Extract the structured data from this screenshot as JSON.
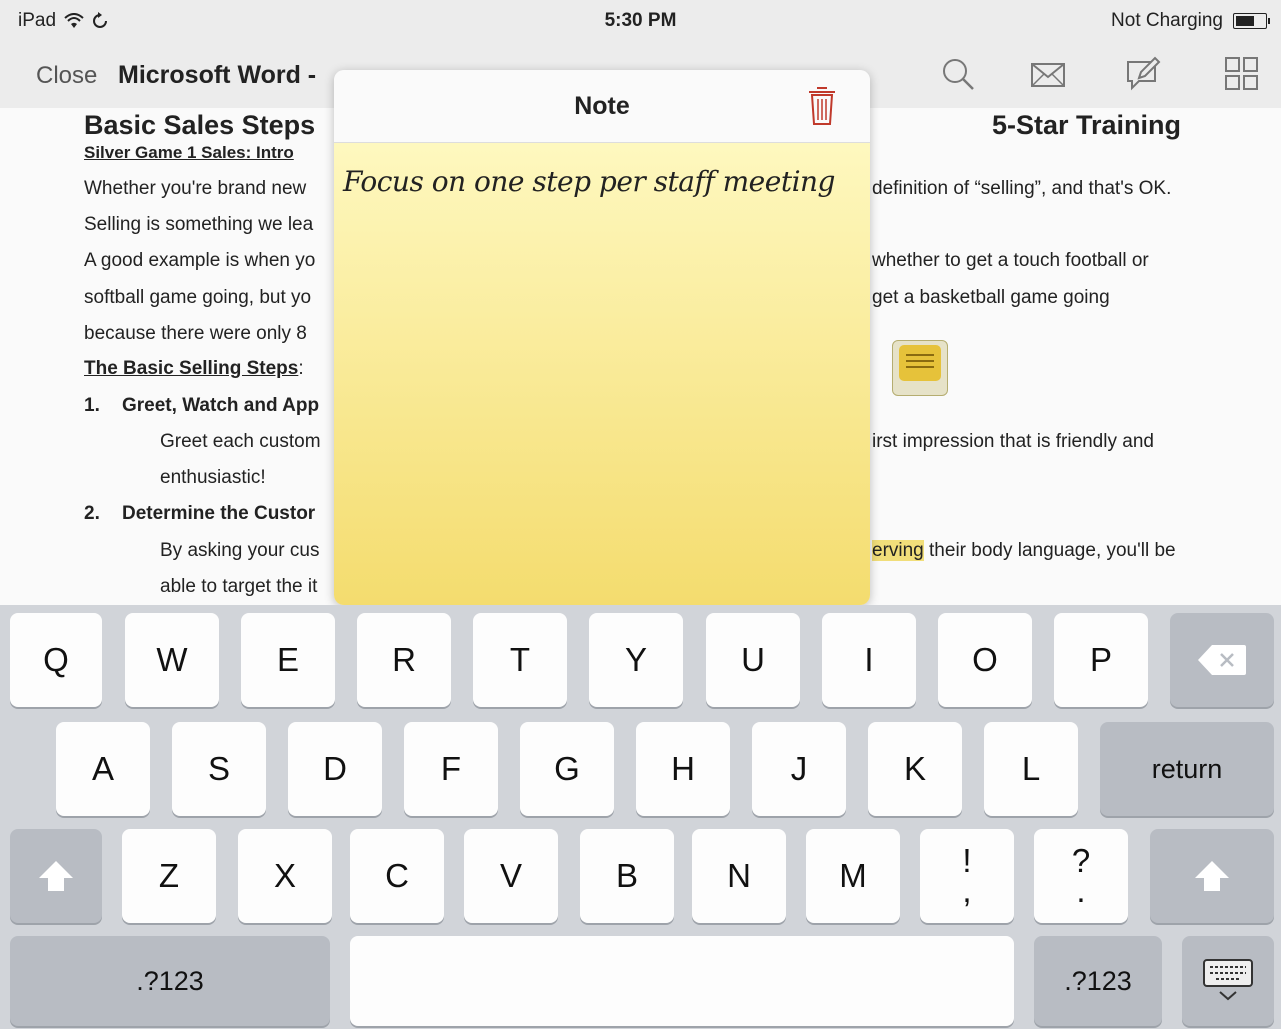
{
  "status": {
    "device": "iPad",
    "time": "5:30 PM",
    "battery_text": "Not Charging"
  },
  "toolbar": {
    "close": "Close",
    "title": "Microsoft Word - "
  },
  "document": {
    "title_left": "Basic Sales Steps",
    "title_right": "5-Star Training",
    "subtitle": "Silver Game 1 Sales: Intro",
    "lines_left": [
      "Whether you're brand new",
      "Selling is something we lea",
      "A good example is when yo",
      "softball game going, but yo",
      "because there were only 8"
    ],
    "lines_right": [
      "definition of “selling”, and that's OK.",
      "whether to get a touch football or",
      "get a basketball game going"
    ],
    "section": "The Basic Selling Steps",
    "step1_num": "1.",
    "step1": "Greet, Watch and App",
    "step1_text": "Greet each custom",
    "step1_right": "irst impression that is friendly and",
    "step1_cont": "enthusiastic!",
    "step2_num": "2.",
    "step2": "Determine the Custor",
    "step2_text": "By asking your cus",
    "step2_right_hl": "erving",
    "step2_right": " their body language, you'll be",
    "step2_cont": "able to target the it"
  },
  "note": {
    "title": "Note",
    "text": "Focus on one step per staff meeting"
  },
  "keyboard": {
    "row1": [
      "Q",
      "W",
      "E",
      "R",
      "T",
      "Y",
      "U",
      "I",
      "O",
      "P"
    ],
    "row2": [
      "A",
      "S",
      "D",
      "F",
      "G",
      "H",
      "J",
      "K",
      "L"
    ],
    "return": "return",
    "row3": [
      "Z",
      "X",
      "C",
      "V",
      "B",
      "N",
      "M"
    ],
    "excl_top": "!",
    "excl_bottom": ",",
    "q_top": "?",
    "q_bottom": ".",
    "numbers": ".?123"
  }
}
